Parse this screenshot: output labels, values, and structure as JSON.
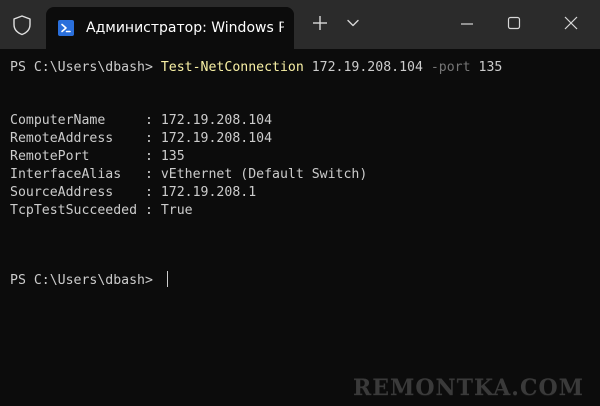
{
  "window": {
    "tab_title": "Администратор: Windows PowerShell",
    "new_tab_glyph": "+",
    "icons": {
      "shield": "shield-icon",
      "tab": "powershell-icon",
      "new_tab": "plus-icon",
      "dropdown": "chevron-down-icon",
      "minimize": "minimize-icon",
      "maximize": "maximize-icon",
      "close": "close-icon"
    }
  },
  "terminal": {
    "prompt": "PS C:\\Users\\dbash> ",
    "command": {
      "cmdlet": "Test-NetConnection",
      "address": "172.19.208.104",
      "param": "-port",
      "port": "135"
    },
    "output": [
      {
        "key": "ComputerName     : ",
        "value": "172.19.208.104"
      },
      {
        "key": "RemoteAddress    : ",
        "value": "172.19.208.104"
      },
      {
        "key": "RemotePort       : ",
        "value": "135"
      },
      {
        "key": "InterfaceAlias   : ",
        "value": "vEthernet (Default Switch)"
      },
      {
        "key": "SourceAddress    : ",
        "value": "172.19.208.1"
      },
      {
        "key": "TcpTestSucceeded : ",
        "value": "True"
      }
    ],
    "second_prompt": "PS C:\\Users\\dbash> "
  },
  "watermark": "REMONTKA.COM",
  "colors": {
    "background": "#0c0c0c",
    "titlebar": "#2b2b2b",
    "text": "#cccccc",
    "cmdlet": "#f9f1a5",
    "parameter": "#767676"
  }
}
